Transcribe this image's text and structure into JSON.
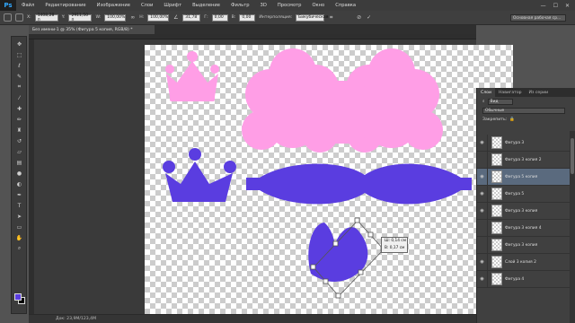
{
  "app": {
    "logo": "Ps"
  },
  "menu": [
    "Файл",
    "Редактирование",
    "Изображение",
    "Слои",
    "Шрифт",
    "Выделение",
    "Фильтр",
    "3D",
    "Просмотр",
    "Окно",
    "Справка"
  ],
  "window_buttons": [
    "—",
    "☐",
    "✕"
  ],
  "options": {
    "x_label": "X:",
    "x_value": "1408,28 п",
    "y_label": "Y:",
    "y_value": "2911,50 п",
    "w_label": "W:",
    "w_value": "100,00%",
    "h_label": "H:",
    "h_value": "100,00%",
    "angle_value": "31,78",
    "hskew_label": "Г:",
    "hskew_value": "0,00",
    "vskew_label": "В:",
    "vskew_value": "0,00",
    "interp_label": "Интерполяция:",
    "interp_value": "Бикубическая",
    "workspace": "Основная рабочая ср..."
  },
  "document_tab": "Без имени-1 @ 35% (Фигура 5 копия, RGB/8) *",
  "tooltip": {
    "line1": "Ш: 0,14 см",
    "line2": "В: 0,17 см"
  },
  "status": "Док: 23,9М/123,4М",
  "colors": {
    "pink": "#ff9ee6",
    "purple": "#5a3de0",
    "selected_layer": "#5a6a7e"
  },
  "panel": {
    "tabs": [
      "Слои",
      "Навигатор",
      "Из серии"
    ],
    "kind_filter": "Вид",
    "blend_mode": "Обычные",
    "lock_label": "Закрепить:",
    "layers": [
      {
        "name": "Фигура 3",
        "visible": true,
        "selected": false
      },
      {
        "name": "Фигура 3 копия 2",
        "visible": false,
        "selected": false
      },
      {
        "name": "Фигура 5 копия",
        "visible": true,
        "selected": true
      },
      {
        "name": "Фигура 5",
        "visible": true,
        "selected": false
      },
      {
        "name": "Фигура 3 копия",
        "visible": true,
        "selected": false
      },
      {
        "name": "Фигура 3 копия 4",
        "visible": false,
        "selected": false
      },
      {
        "name": "Фигура 3 копия",
        "visible": false,
        "selected": false
      },
      {
        "name": "Слой 3 копия 2",
        "visible": true,
        "selected": false
      },
      {
        "name": "Фигура 4",
        "visible": true,
        "selected": false
      }
    ]
  },
  "tool_icons": [
    "move-icon",
    "marquee-icon",
    "lasso-icon",
    "quick-select-icon",
    "crop-icon",
    "eyedropper-icon",
    "healing-icon",
    "brush-icon",
    "clone-stamp-icon",
    "history-brush-icon",
    "eraser-icon",
    "gradient-icon",
    "blur-icon",
    "dodge-icon",
    "pen-icon",
    "type-icon",
    "path-select-icon",
    "shape-icon",
    "hand-icon",
    "zoom-icon"
  ]
}
